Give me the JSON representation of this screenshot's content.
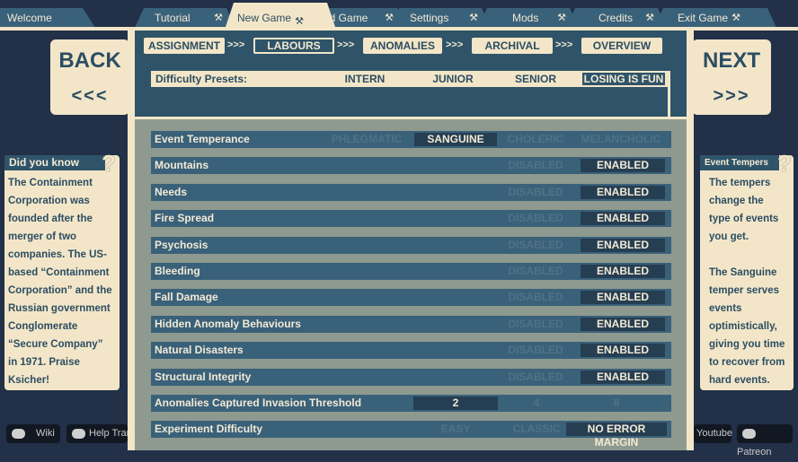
{
  "tabs": [
    {
      "label": "Welcome",
      "icon": ""
    },
    {
      "label": "Tutorial",
      "icon": "⚒"
    },
    {
      "label": "New Game",
      "icon": "⚒"
    },
    {
      "label": "ad Game",
      "icon": "⚒"
    },
    {
      "label": "Settings",
      "icon": "⚒"
    },
    {
      "label": "Mods",
      "icon": "⚒"
    },
    {
      "label": "Credits",
      "icon": "⚒"
    },
    {
      "label": "Exit Game",
      "icon": "⚒"
    }
  ],
  "back": {
    "label": "BACK",
    "arrows": "<<<"
  },
  "next": {
    "label": "NEXT",
    "arrows": ">>>"
  },
  "steps": [
    "ASSIGNMENT",
    "LABOURS",
    "ANOMALIES",
    "ARCHIVAL",
    "OVERVIEW"
  ],
  "step_sep": ">>>",
  "presets": {
    "label": "Difficulty Presets:",
    "options": [
      "INTERN",
      "JUNIOR",
      "SENIOR",
      "LOSING IS FUN"
    ],
    "selected": "LOSING IS FUN"
  },
  "rows": [
    {
      "label": "Event Temperance",
      "options": [
        "PHLEGMATIC",
        "SANGUINE",
        "CHOLERIC",
        "MELANCHOLIC"
      ],
      "selected": 1
    },
    {
      "label": "Mountains",
      "options": [
        "DISABLED",
        "ENABLED"
      ],
      "selected": 1
    },
    {
      "label": "Needs",
      "options": [
        "DISABLED",
        "ENABLED"
      ],
      "selected": 1
    },
    {
      "label": "Fire Spread",
      "options": [
        "DISABLED",
        "ENABLED"
      ],
      "selected": 1
    },
    {
      "label": "Psychosis",
      "options": [
        "DISABLED",
        "ENABLED"
      ],
      "selected": 1
    },
    {
      "label": "Bleeding",
      "options": [
        "DISABLED",
        "ENABLED"
      ],
      "selected": 1
    },
    {
      "label": "Fall Damage",
      "options": [
        "DISABLED",
        "ENABLED"
      ],
      "selected": 1
    },
    {
      "label": "Hidden Anomaly Behaviours",
      "options": [
        "DISABLED",
        "ENABLED"
      ],
      "selected": 1
    },
    {
      "label": "Natural Disasters",
      "options": [
        "DISABLED",
        "ENABLED"
      ],
      "selected": 1
    },
    {
      "label": "Structural Integrity",
      "options": [
        "DISABLED",
        "ENABLED"
      ],
      "selected": 1
    },
    {
      "label": "Anomalies Captured Invasion Threshold",
      "options": [
        "2",
        "4",
        "8"
      ],
      "selected": 0
    },
    {
      "label": "Experiment Difficulty",
      "options": [
        "EASY",
        "CLASSIC",
        "NO ERROR MARGIN"
      ],
      "selected": 2
    }
  ],
  "tip_left": {
    "title": "Did you know",
    "mark": "?",
    "lines": [
      "The Containment",
      "Corporation was",
      "founded after the",
      "merger of two",
      "companies. The US-",
      "based “Containment",
      "Corporation” and the",
      "Russian government",
      "Conglomerate",
      "“Secure Company”",
      "in 1971. Praise",
      "Ksicher!"
    ]
  },
  "tip_right": {
    "title": "Event Tempers",
    "mark": "?",
    "lines": [
      "The tempers",
      "change the",
      "type of events",
      "you get.",
      "",
      "The Sanguine",
      "temper serves",
      "events",
      "optimistically,",
      "giving you time",
      "to recover from",
      "hard events."
    ]
  },
  "footer": {
    "wiki": "Wiki",
    "help": "Help Trans",
    "youtube": "Youtube",
    "patreon": "Patreon"
  }
}
